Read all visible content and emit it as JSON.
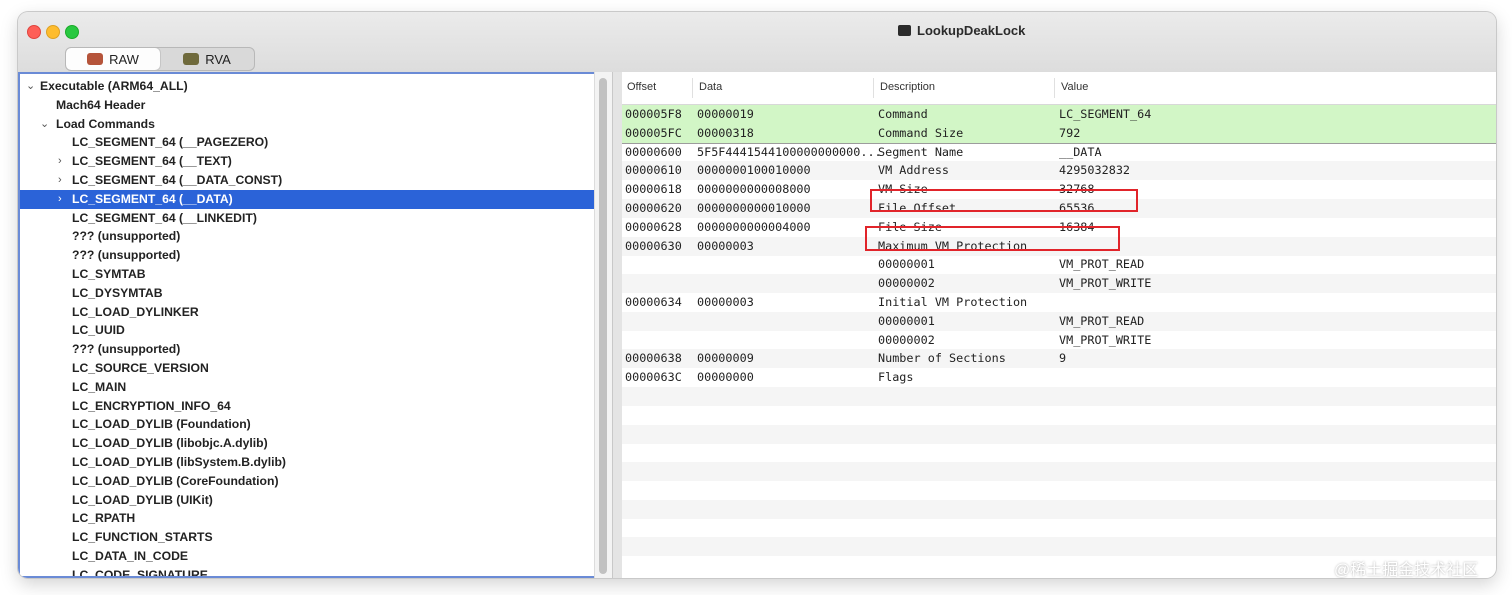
{
  "window": {
    "title": "LookupDeakLock",
    "title_icon": "app-window-icon"
  },
  "toolbar": {
    "segments": [
      {
        "label": "RAW",
        "icon": "raw-icon",
        "active": true
      },
      {
        "label": "RVA",
        "icon": "rva-icon",
        "active": false
      }
    ]
  },
  "tree": {
    "items": [
      {
        "label": "Executable  (ARM64_ALL)",
        "level": 0,
        "chevron": "⌄",
        "selected": false
      },
      {
        "label": "Mach64 Header",
        "level": 1,
        "chevron": "",
        "selected": false
      },
      {
        "label": "Load Commands",
        "level": 1,
        "chevron": "⌄",
        "selected": false
      },
      {
        "label": "LC_SEGMENT_64 (__PAGEZERO)",
        "level": 2,
        "chevron": "",
        "selected": false
      },
      {
        "label": "LC_SEGMENT_64 (__TEXT)",
        "level": 2,
        "chevron": "›",
        "selected": false
      },
      {
        "label": "LC_SEGMENT_64 (__DATA_CONST)",
        "level": 2,
        "chevron": "›",
        "selected": false
      },
      {
        "label": "LC_SEGMENT_64 (__DATA)",
        "level": 2,
        "chevron": "›",
        "selected": true
      },
      {
        "label": "LC_SEGMENT_64 (__LINKEDIT)",
        "level": 2,
        "chevron": "",
        "selected": false
      },
      {
        "label": "??? (unsupported)",
        "level": 2,
        "chevron": "",
        "selected": false
      },
      {
        "label": "??? (unsupported)",
        "level": 2,
        "chevron": "",
        "selected": false
      },
      {
        "label": "LC_SYMTAB",
        "level": 2,
        "chevron": "",
        "selected": false
      },
      {
        "label": "LC_DYSYMTAB",
        "level": 2,
        "chevron": "",
        "selected": false
      },
      {
        "label": "LC_LOAD_DYLINKER",
        "level": 2,
        "chevron": "",
        "selected": false
      },
      {
        "label": "LC_UUID",
        "level": 2,
        "chevron": "",
        "selected": false
      },
      {
        "label": "??? (unsupported)",
        "level": 2,
        "chevron": "",
        "selected": false
      },
      {
        "label": "LC_SOURCE_VERSION",
        "level": 2,
        "chevron": "",
        "selected": false
      },
      {
        "label": "LC_MAIN",
        "level": 2,
        "chevron": "",
        "selected": false
      },
      {
        "label": "LC_ENCRYPTION_INFO_64",
        "level": 2,
        "chevron": "",
        "selected": false
      },
      {
        "label": "LC_LOAD_DYLIB (Foundation)",
        "level": 2,
        "chevron": "",
        "selected": false
      },
      {
        "label": "LC_LOAD_DYLIB (libobjc.A.dylib)",
        "level": 2,
        "chevron": "",
        "selected": false
      },
      {
        "label": "LC_LOAD_DYLIB (libSystem.B.dylib)",
        "level": 2,
        "chevron": "",
        "selected": false
      },
      {
        "label": "LC_LOAD_DYLIB (CoreFoundation)",
        "level": 2,
        "chevron": "",
        "selected": false
      },
      {
        "label": "LC_LOAD_DYLIB (UIKit)",
        "level": 2,
        "chevron": "",
        "selected": false
      },
      {
        "label": "LC_RPATH",
        "level": 2,
        "chevron": "",
        "selected": false
      },
      {
        "label": "LC_FUNCTION_STARTS",
        "level": 2,
        "chevron": "",
        "selected": false
      },
      {
        "label": "LC_DATA_IN_CODE",
        "level": 2,
        "chevron": "",
        "selected": false
      },
      {
        "label": "LC_CODE_SIGNATURE",
        "level": 2,
        "chevron": "",
        "selected": false
      }
    ]
  },
  "table": {
    "columns": [
      "Offset",
      "Data",
      "Description",
      "Value"
    ],
    "rows": [
      {
        "offset": "000005F8",
        "data": "00000019",
        "description": "Command",
        "value": "LC_SEGMENT_64",
        "highlight": "green"
      },
      {
        "offset": "000005FC",
        "data": "00000318",
        "description": "Command Size",
        "value": "792",
        "highlight": "green"
      },
      {
        "offset": "00000600",
        "data": "5F5F4441544100000000000...",
        "description": "Segment Name",
        "value": "__DATA",
        "highlight": ""
      },
      {
        "offset": "00000610",
        "data": "0000000100010000",
        "description": "VM Address",
        "value": "4295032832",
        "highlight": ""
      },
      {
        "offset": "00000618",
        "data": "0000000000008000",
        "description": "VM Size",
        "value": "32768",
        "highlight": ""
      },
      {
        "offset": "00000620",
        "data": "0000000000010000",
        "description": "File Offset",
        "value": "65536",
        "highlight": ""
      },
      {
        "offset": "00000628",
        "data": "0000000000004000",
        "description": "File Size",
        "value": "16384",
        "highlight": ""
      },
      {
        "offset": "00000630",
        "data": "00000003",
        "description": "Maximum VM Protection",
        "value": "",
        "highlight": ""
      },
      {
        "offset": "",
        "data": "",
        "description": "00000001",
        "value": "VM_PROT_READ",
        "highlight": ""
      },
      {
        "offset": "",
        "data": "",
        "description": "00000002",
        "value": "VM_PROT_WRITE",
        "highlight": ""
      },
      {
        "offset": "00000634",
        "data": "00000003",
        "description": "Initial VM Protection",
        "value": "",
        "highlight": ""
      },
      {
        "offset": "",
        "data": "",
        "description": "00000001",
        "value": "VM_PROT_READ",
        "highlight": ""
      },
      {
        "offset": "",
        "data": "",
        "description": "00000002",
        "value": "VM_PROT_WRITE",
        "highlight": ""
      },
      {
        "offset": "00000638",
        "data": "00000009",
        "description": "Number of Sections",
        "value": "9",
        "highlight": ""
      },
      {
        "offset": "0000063C",
        "data": "00000000",
        "description": "Flags",
        "value": "",
        "highlight": ""
      }
    ],
    "annotated_rows": [
      "VM Size",
      "File Size"
    ],
    "annotation_color": "#e1242a"
  },
  "watermark": "@稀土掘金技术社区",
  "colors": {
    "selection": "#2b63d8",
    "command_rows": "#d2f6c6"
  }
}
